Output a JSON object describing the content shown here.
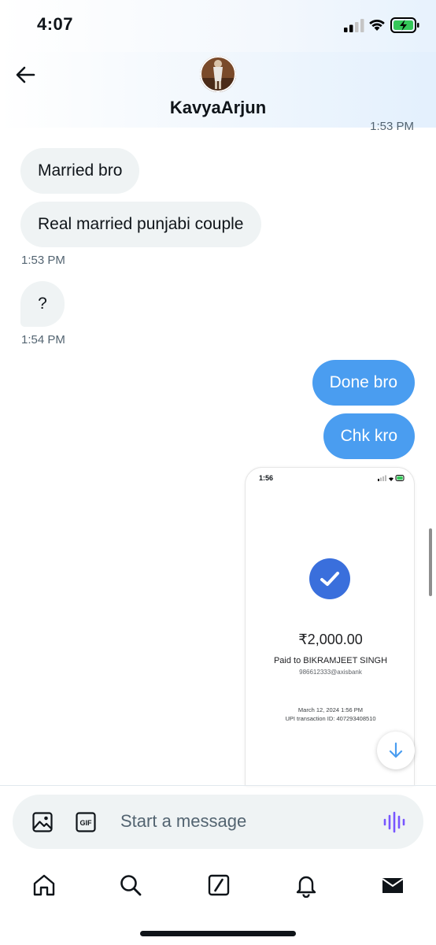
{
  "status_bar": {
    "time": "4:07"
  },
  "header": {
    "name": "KavyaArjun"
  },
  "messages": {
    "cut_timestamp": "1:53 PM",
    "incoming_1": "Married bro",
    "incoming_2": "Real married punjabi couple",
    "time_1": "1:53 PM",
    "incoming_3": "?",
    "time_2": "1:54 PM",
    "outgoing_1": "Done bro",
    "outgoing_2": "Chk kro"
  },
  "attachment": {
    "time": "1:56",
    "amount": "₹2,000.00",
    "payee": "Paid to BIKRAMJEET SINGH",
    "upi_id": "986612333@axisbank",
    "date": "March 12, 2024 1:56 PM",
    "transaction": "UPI transaction ID: 407293408510"
  },
  "composer": {
    "placeholder": "Start a message",
    "gif_label": "GIF"
  },
  "tabs": [
    "home",
    "search",
    "grok",
    "notifications",
    "messages"
  ],
  "icons": [
    "back-arrow-icon",
    "image-icon",
    "gif-icon",
    "voice-waveform-icon",
    "home-icon",
    "search-icon",
    "grok-icon",
    "bell-icon",
    "envelope-icon",
    "arrow-down-icon",
    "checkmark-icon"
  ],
  "colors": {
    "accent": "#4a9df0",
    "incoming_bubble": "#eff3f4",
    "voice": "#7856ff",
    "check": "#3a6fdc"
  }
}
